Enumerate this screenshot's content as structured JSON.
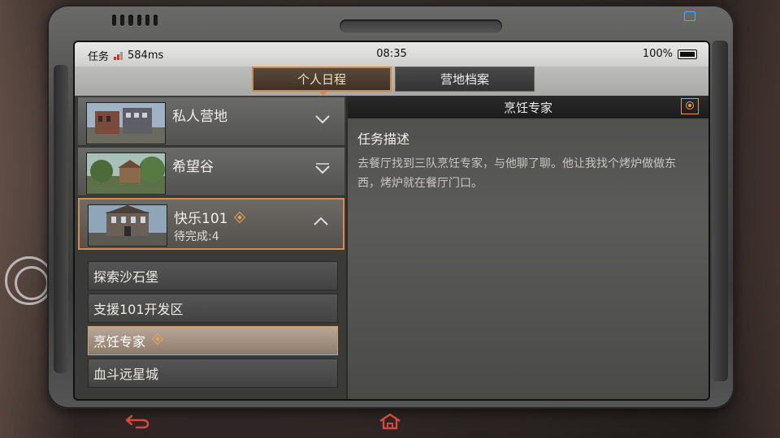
{
  "statusbar": {
    "mode_label": "任务",
    "ping": "584ms",
    "time": "08:35",
    "battery": "100%"
  },
  "tabs": [
    {
      "label": "个人日程",
      "active": true
    },
    {
      "label": "营地档案",
      "active": false
    }
  ],
  "bases": [
    {
      "name": "私人营地",
      "subtitle": "",
      "expanded": false
    },
    {
      "name": "希望谷",
      "subtitle": "",
      "expanded": false
    },
    {
      "name": "快乐101",
      "subtitle": "待完成:4",
      "expanded": true
    }
  ],
  "tasks": [
    {
      "label": "探索沙石堡",
      "selected": false
    },
    {
      "label": "支援101开发区",
      "selected": false
    },
    {
      "label": "烹饪专家",
      "selected": true
    },
    {
      "label": "血斗远星城",
      "selected": false
    }
  ],
  "detail": {
    "header": "烹饪专家",
    "section_title": "任务描述",
    "description": "去餐厅找到三队烹饪专家，与他聊了聊。他让我找个烤炉做做东西，烤炉就在餐厅门口。"
  },
  "colors": {
    "accent": "#d68a4b",
    "marker": "#e8a34a",
    "button_red": "#d9463c"
  }
}
